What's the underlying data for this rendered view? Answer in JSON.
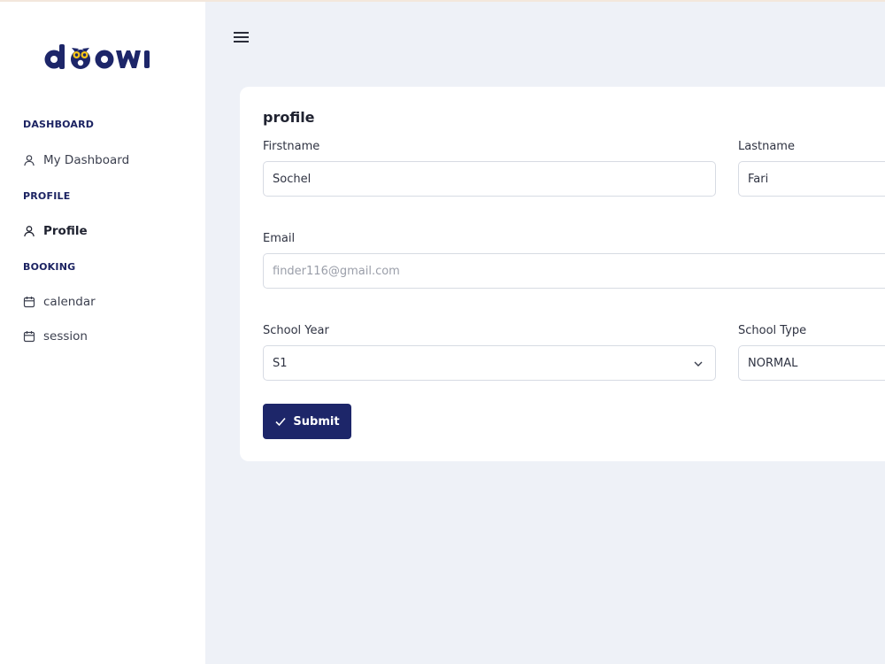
{
  "brand": {
    "logo_text": "doowi",
    "primary_color": "#1d2669",
    "accent_color": "#f5c518"
  },
  "sidebar": {
    "sections": [
      {
        "title": "DASHBOARD",
        "items": [
          {
            "label": "My Dashboard",
            "icon": "user-icon"
          }
        ]
      },
      {
        "title": "PROFILE",
        "items": [
          {
            "label": "Profile",
            "icon": "user-icon",
            "active": true
          }
        ]
      },
      {
        "title": "BOOKING",
        "items": [
          {
            "label": "calendar",
            "icon": "calendar-icon"
          },
          {
            "label": "session",
            "icon": "calendar-icon"
          }
        ]
      }
    ]
  },
  "header": {
    "menu_icon": "hamburger-menu-icon"
  },
  "profile_form": {
    "title": "profile",
    "firstname": {
      "label": "Firstname",
      "value": "Sochel"
    },
    "lastname": {
      "label": "Lastname",
      "value": "Fari"
    },
    "email": {
      "label": "Email",
      "value": "finder116@gmail.com"
    },
    "school_year": {
      "label": "School Year",
      "value": "S1"
    },
    "school_type": {
      "label": "School Type",
      "value": "NORMAL"
    },
    "submit_label": "Submit"
  }
}
